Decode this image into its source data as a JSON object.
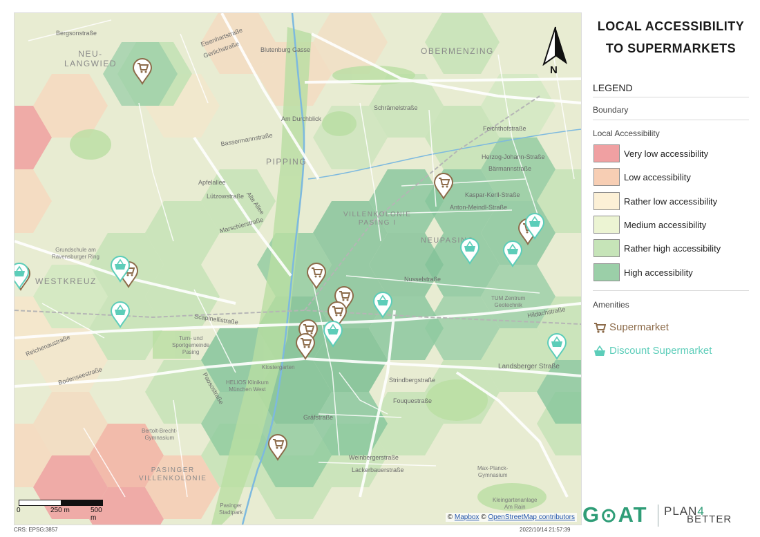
{
  "title": "LOCAL ACCESSIBILITY\nTO SUPERMARKETS",
  "legend": {
    "heading": "LEGEND",
    "boundary_label": "Boundary",
    "accessibility_heading": "Local Accessibility",
    "classes": [
      {
        "label": "Very low accessibility",
        "color": "#f0a0a2"
      },
      {
        "label": "Low accessibility",
        "color": "#f7ceb4"
      },
      {
        "label": "Rather low accessibility",
        "color": "#fcf0d6"
      },
      {
        "label": "Medium accessibility",
        "color": "#ecf4d3"
      },
      {
        "label": "Rather high accessibility",
        "color": "#c6e4b8"
      },
      {
        "label": "High accessibility",
        "color": "#9bcfa8"
      }
    ],
    "amenities_heading": "Amenities",
    "amenities": [
      {
        "label": "Supermarket",
        "color": "#8c6b4a",
        "icon": "shopping-cart-icon"
      },
      {
        "label": "Discount Supermarket",
        "color": "#5ccdb9",
        "icon": "shopping-basket-icon"
      }
    ]
  },
  "map": {
    "north_label": "N",
    "scale_labels": [
      "0",
      "250 m",
      "500 m"
    ],
    "attribution": {
      "prefix": "©",
      "mapbox": "Mapbox",
      "mid": "©",
      "osm": "OpenStreetMap contributors"
    },
    "crs": "CRS: EPSG:3857",
    "timestamp": "2022/10/14 21:57:39",
    "districts": {
      "neu_langwied": "NEU-\nLANGWIED",
      "obermenzing": "OBERMENZING",
      "pipping": "PIPPING",
      "villenkolonie_pasing": "VILLENKOLONIE\nPASING I",
      "neupasing": "NEUPASING",
      "westkreuz": "WESTKREUZ",
      "pasinger_villenkolonie": "PASINGER\nVILLENKOLONIE"
    },
    "streets": {
      "bergsonstrasse": "Bergsonstraße",
      "eisenhartstrasse": "Eisenhartstraße",
      "gerlichstrasse": "Gerlichstraße",
      "blutenburg": "Blutenburg Gasse",
      "am_durchblick": "Am Durchblick",
      "schraemelstrasse": "Schrämelstraße",
      "bassermannstrasse": "Bassermannstraße",
      "apfelallee": "Apfelallee",
      "luetzowstrasse": "Lützowstraße",
      "marschierstrasse": "Marschierstraße",
      "alte_allee": "Alte Allee",
      "herzog_johann": "Herzog-Johann-Straße",
      "baermannstrasse": "Bärmannstraße",
      "kaspar_kerll": "Kaspar-Kerll-Straße",
      "anton_meindl": "Anton-Meindl-Straße",
      "feichthofstrasse": "Feichthofstraße",
      "nusselstrasse": "Nusselstraße",
      "scapinellistrasse": "Scapinellistraße",
      "reichenaustrasse": "Reichenaustraße",
      "bodenseestrasse": "Bodenseestraße",
      "landsberger_strasse": "Landsberger Straße",
      "strindbergstrasse": "Strindbergstraße",
      "fouquestrasse": "Fouquestraße",
      "graefstrasse": "Gräfstraße",
      "weinbergerstrasse": "Weinbergerstraße",
      "lackerbauerstrasse": "Lackerbauerstraße",
      "hildachstrasse": "Hildachstraße",
      "paosostrasse": "Paosostraße",
      "kleingartenanlage": "Kleingartenanlage\nAm Rain",
      "pasinger_stadtpark": "Pasinger\nStadtpark",
      "klostergarten": "Klostergarten",
      "helios": "HELIOS Klinikum\nMünchen West",
      "grundschule": "Grundschule am\nRavensburger Ring",
      "bertolt": "Bertolt-Brecht-\nGymnasium",
      "tum": "TUM Zentrum\nGeotechnik",
      "max_planck": "Max-Planck-\nGymnasium",
      "turn_sport": "Turn- und\nSportgemeinde\nPasing"
    }
  }
}
